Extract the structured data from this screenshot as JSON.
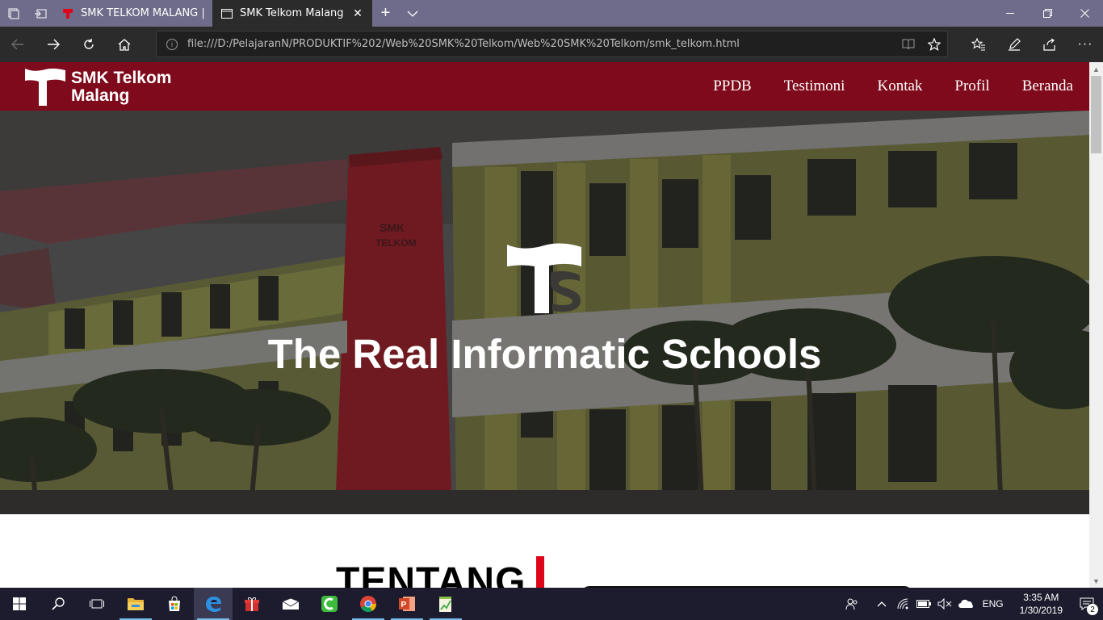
{
  "browser": {
    "tabs": [
      {
        "title": "SMK TELKOM MALANG | Th",
        "active": false
      },
      {
        "title": "SMK Telkom Malang",
        "active": true
      }
    ],
    "address": "file:///D:/PelajaranN/PRODUKTIF%202/Web%20SMK%20Telkom/Web%20SMK%20Telkom/smk_telkom.html"
  },
  "site": {
    "brand": {
      "line1": "SMK Telkom",
      "line2": "Malang"
    },
    "menu": [
      "PPDB",
      "Testimoni",
      "Kontak",
      "Profil",
      "Beranda"
    ],
    "hero_title": "The Real Informatic Schools",
    "building_sign": {
      "line1": "SMK",
      "line2": "TELKOM"
    },
    "about_title": "TENTANG"
  },
  "taskbar": {
    "language": "ENG",
    "time": "3:35 AM",
    "date": "1/30/2019",
    "notification_count": "2"
  },
  "colors": {
    "header_bg": "#7f0a1b",
    "accent_red": "#e0061a",
    "browser_chrome": "#2b2b2b",
    "titlebar": "#6e6c8a"
  }
}
